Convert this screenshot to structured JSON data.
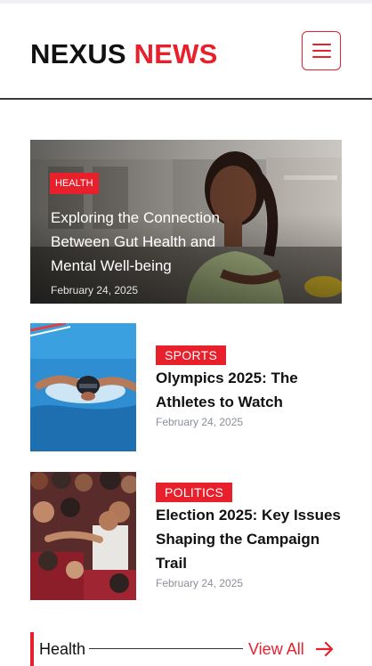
{
  "header": {
    "logo_part1": "NEXUS",
    "logo_part2": "NEWS",
    "menu_icon": "hamburger-menu-icon"
  },
  "featured": {
    "category": "HEALTH",
    "title": "Exploring the Connection Between Gut Health and Mental Well-being",
    "date": "February 24, 2025"
  },
  "articles": [
    {
      "category": "SPORTS",
      "title": "Olympics 2025: The Athletes to Watch",
      "date": "February 24, 2025"
    },
    {
      "category": "POLITICS",
      "title": "Election 2025: Key Issues Shaping the Campaign Trail",
      "date": "February 24, 2025"
    }
  ],
  "section": {
    "name": "Health",
    "view_all": "View All",
    "arrow_icon": "arrow-right-icon"
  },
  "colors": {
    "accent": "#e8202c",
    "text": "#111111",
    "muted": "#8a8f98"
  }
}
